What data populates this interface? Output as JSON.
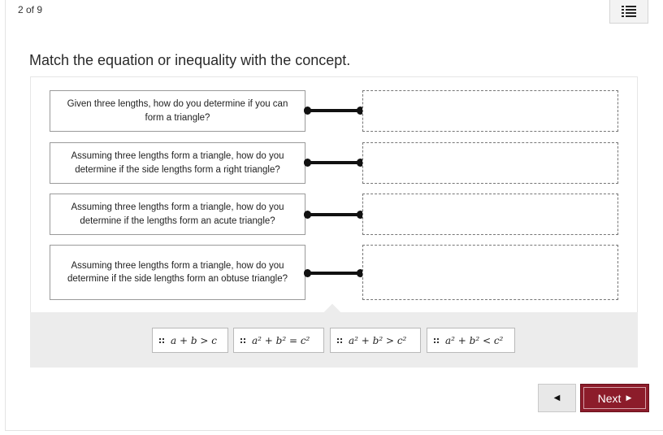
{
  "header": {
    "progress": "2 of 9"
  },
  "question": {
    "title": "Match the equation or inequality with the concept."
  },
  "prompts": [
    "Given three lengths, how do you determine if you can form a triangle?",
    "Assuming three lengths form a triangle, how do you determine if the side lengths form a right triangle?",
    "Assuming three lengths form a triangle, how do you determine if the lengths form an acute triangle?",
    "Assuming three lengths form a triangle, how do you determine if the side lengths form an obtuse triangle?"
  ],
  "answer_bank": {
    "tiles": [
      "a + b > c",
      "a² + b² = c²",
      "a² + b² > c²",
      "a² + b² < c²"
    ]
  },
  "navigation": {
    "prev_icon": "◀",
    "next_label": "Next",
    "next_icon": "▶"
  },
  "colors": {
    "next_button": "#8c1c2a",
    "bank_background": "#ececec"
  },
  "icons": {
    "menu": "list-menu-icon",
    "drag": "drag-handle-icon"
  }
}
